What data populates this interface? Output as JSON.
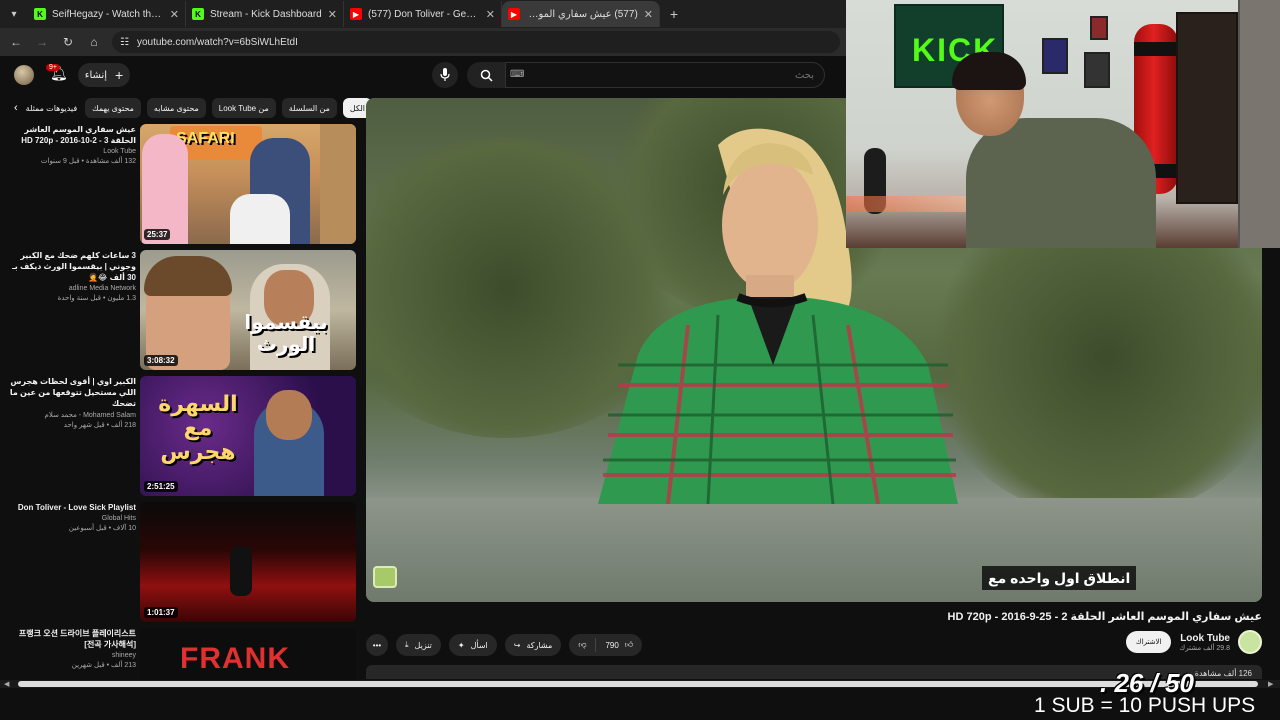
{
  "browser": {
    "tabs": [
      {
        "title": "SeifHegazy - Watch the VOD o",
        "favicon": "kick"
      },
      {
        "title": "Stream - Kick Dashboard",
        "favicon": "kick"
      },
      {
        "title": "(577) Don Toliver - Gemstone (",
        "favicon": "youtube"
      },
      {
        "title": "(577) عيش سفاري الموسم العاشر",
        "favicon": "youtube",
        "active": true
      }
    ],
    "url": "youtube.com/watch?v=6bSiWLhEtdI"
  },
  "header": {
    "notif_count": "9+",
    "create_label": "إنشاء",
    "search_placeholder": "بحث"
  },
  "chips": [
    "الكل",
    "من السلسلة",
    "من Look Tube",
    "محتوى مشابه",
    "محتوى يهمك",
    "فيديوهات ممثلة"
  ],
  "recommendations": [
    {
      "title": "عيش سفاري الموسم العاشر الحلقة 3 - 2-10-2016 - HD 720p",
      "channel": "Look Tube",
      "views": "132 ألف مشاهدة • قبل 9 سنوات",
      "duration": "25:37"
    },
    {
      "title": "3 ساعات كلهم ضحك مع الكبير وجوني | بيقسموا الورث ديكف بـ 30 ألف 😂🤦",
      "channel": "adline Media Network",
      "views": "1.3 مليون • قبل سنة واحدة",
      "duration": "3:08:32"
    },
    {
      "title": "الكبير اوي | أقوى لحظات هجرس اللي مستحيل تتوقعها من عين ما تضحك",
      "channel": "Mohamed Salam - محمد سلام",
      "views": "218 ألف • قبل شهر واحد",
      "duration": "2:51:25"
    },
    {
      "title": "Don Toliver - Love Sick Playlist",
      "channel": "Global Hits",
      "views": "10 آلاف • قبل أسبوعين",
      "duration": "1:01:37"
    },
    {
      "title": "프랭크 오션 드라이브 플레이리스트 [전곡 가사해석]",
      "channel": "shineey",
      "views": "213 ألف • قبل شهرين",
      "duration": ""
    }
  ],
  "thumb_texts": {
    "rec1": "SAFARI",
    "rec2": "بيقسموا الورث",
    "rec3": "السهرة مع هجرس",
    "rec5": "FRANK OCEAN"
  },
  "video": {
    "subtitle": "انطلاق اول واحده مع",
    "title": "عيش سفاري الموسم العاشر الحلقة 2 - 25-9-2016 - HD 720p",
    "channel": "Look Tube",
    "subscribers": "29.8 ألف مشترك",
    "subscribe_label": "الاشتراك",
    "likes": "790",
    "share_label": "مشاركة",
    "ask_label": "اسأل",
    "download_label": "تنزيل",
    "description_stub": "126 ألف مشاهدة"
  },
  "overlay": {
    "counter": ". 26 / 50",
    "pushups": "1 SUB = 10 PUSH UPS"
  },
  "webcam": {
    "flag_text": "KICK"
  },
  "colors": {
    "yt_bg": "#0f0f0f",
    "kick_green": "#53fc18",
    "yt_red": "#ff0000"
  }
}
